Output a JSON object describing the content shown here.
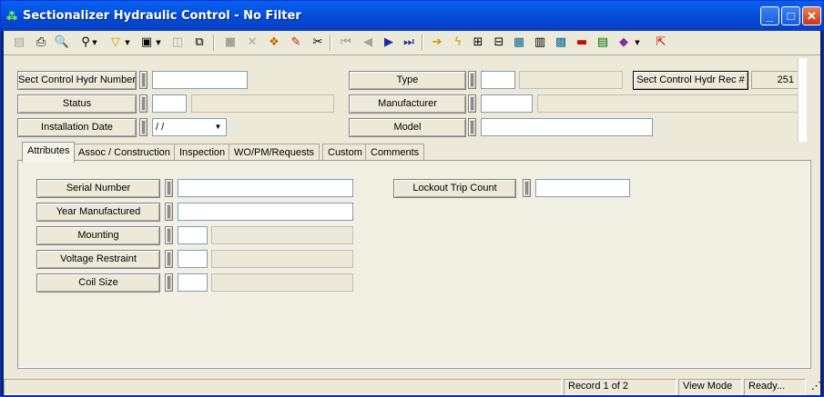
{
  "window": {
    "title": "Sectionalizer Hydraulic Control - No Filter",
    "minimize": "_",
    "maximize": "□",
    "close": "✕"
  },
  "toolbar": {
    "icons": [
      "save-icon",
      "print-icon",
      "print-preview-icon",
      "find-icon",
      "filter-icon",
      "report-icon",
      "new-record-icon",
      "copy-record-icon",
      "save-record-icon",
      "delete-icon",
      "spell-check-icon",
      "edit-icon",
      "cut-icon",
      "first-record-icon",
      "previous-record-icon",
      "next-record-icon",
      "last-record-icon",
      "jump-icon",
      "lightning-icon",
      "structure-icon",
      "hierarchy-icon",
      "map-icon",
      "calculator-icon",
      "image-icon",
      "link-icon",
      "grid-icon",
      "book-icon",
      "exit-icon"
    ]
  },
  "header": {
    "sect_control_hydr_number_label": "Sect Control Hydr Number",
    "sect_control_hydr_number_value": "",
    "status_label": "Status",
    "status_code": "",
    "status_desc": "",
    "installation_date_label": "Installation Date",
    "installation_date_value": " / /",
    "type_label": "Type",
    "type_code": "",
    "type_desc": "",
    "manufacturer_label": "Manufacturer",
    "manufacturer_code": "",
    "manufacturer_desc": "",
    "model_label": "Model",
    "model_value": "",
    "rec_label": "Sect Control Hydr Rec #",
    "rec_value": "251"
  },
  "tabs": [
    {
      "label": "Attributes",
      "active": true
    },
    {
      "label": "Assoc / Construction",
      "active": false
    },
    {
      "label": "Inspection",
      "active": false
    },
    {
      "label": "WO/PM/Requests",
      "active": false
    },
    {
      "label": "Custom",
      "active": false
    },
    {
      "label": "Comments",
      "active": false
    }
  ],
  "attributes": {
    "serial_number_label": "Serial Number",
    "serial_number_value": "",
    "year_manufactured_label": "Year Manufactured",
    "year_manufactured_value": "",
    "mounting_label": "Mounting",
    "voltage_restraint_label": "Voltage Restraint",
    "coil_size_label": "Coil Size",
    "lockout_trip_count_label": "Lockout Trip Count",
    "lockout_trip_count_value": ""
  },
  "status": {
    "record": "Record 1 of 2",
    "mode": "View Mode",
    "state": "Ready..."
  }
}
